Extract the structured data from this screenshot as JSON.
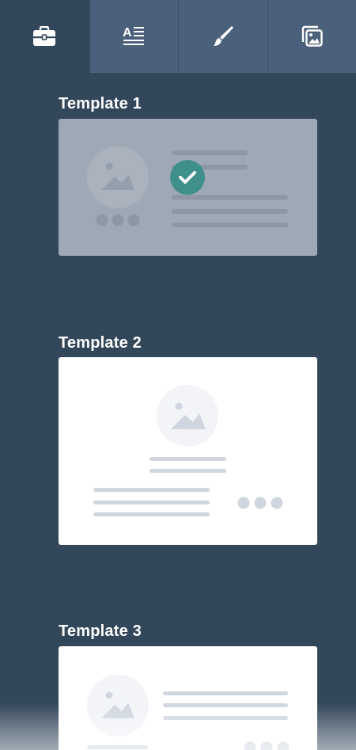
{
  "tabs": [
    {
      "id": "templates",
      "icon": "briefcase-icon",
      "active": true
    },
    {
      "id": "text",
      "icon": "text-format-icon",
      "active": false
    },
    {
      "id": "style",
      "icon": "paintbrush-icon",
      "active": false
    },
    {
      "id": "images",
      "icon": "image-gallery-icon",
      "active": false
    }
  ],
  "templates": [
    {
      "title": "Template 1",
      "selected": true
    },
    {
      "title": "Template 2",
      "selected": false
    },
    {
      "title": "Template 3",
      "selected": false
    }
  ],
  "colors": {
    "panel_bg": "#33475b",
    "tab_bg": "#4b607a",
    "selected_card": "#9fa8b5",
    "check_badge": "#3f8f8b",
    "placeholder": "#cfd6df"
  }
}
